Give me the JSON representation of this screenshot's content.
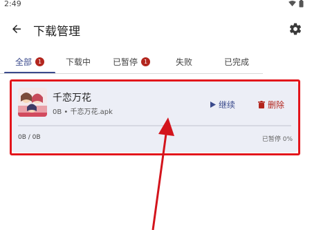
{
  "status_bar": {
    "time": "2:49"
  },
  "app_bar": {
    "title": "下载管理"
  },
  "tabs": [
    {
      "label": "全部",
      "badge": "1",
      "active": true
    },
    {
      "label": "下载中",
      "badge": "",
      "active": false
    },
    {
      "label": "已暂停",
      "badge": "1",
      "active": false
    },
    {
      "label": "失败",
      "badge": "",
      "active": false
    },
    {
      "label": "已完成",
      "badge": "",
      "active": false
    }
  ],
  "download_item": {
    "title": "千恋万花",
    "subtitle": "0B • 千恋万花.apk",
    "resume_label": "继续",
    "delete_label": "删除",
    "size": "0B / 0B",
    "status": "已暂停 0%",
    "progress": 0
  },
  "colors": {
    "primary": "#3a4a8c",
    "danger": "#b3261e",
    "highlight": "#e3141b",
    "card_bg": "#eceef6"
  },
  "icons": {
    "back": "arrow-left-icon",
    "settings": "gear-icon",
    "resume": "play-icon",
    "delete": "trash-icon"
  }
}
